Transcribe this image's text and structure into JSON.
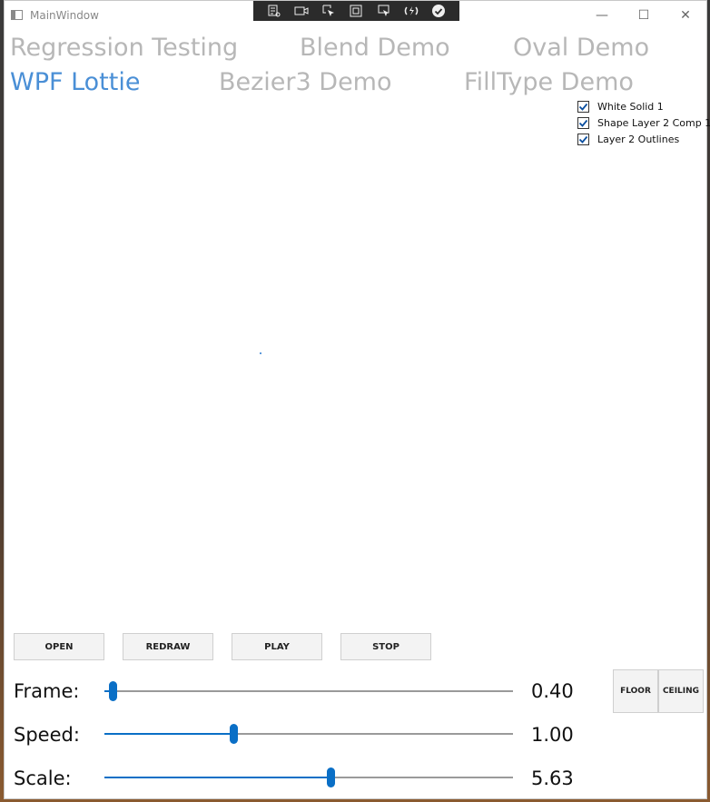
{
  "window": {
    "title": "MainWindow"
  },
  "window_controls": {
    "minimize": "—",
    "maximize": "☐",
    "close": "✕"
  },
  "debug_toolbar": {
    "icons": [
      "live-visual-tree-icon",
      "camera-icon",
      "select-element-icon",
      "layout-adorner-icon",
      "display-layout-icon",
      "hot-reload-icon",
      "check-icon"
    ]
  },
  "nav": {
    "regression": "Regression Testing",
    "blend": "Blend Demo",
    "oval": "Oval Demo",
    "wpf": "WPF Lottie",
    "bezier": "Bezier3 Demo",
    "filltype": "FillType Demo"
  },
  "layers": [
    {
      "label": "White Solid 1",
      "checked": true
    },
    {
      "label": "Shape Layer 2 Comp 1",
      "checked": true
    },
    {
      "label": "Layer 2 Outlines",
      "checked": true
    }
  ],
  "buttons": {
    "open": "OPEN",
    "redraw": "REDRAW",
    "play": "PLAY",
    "stop": "STOP",
    "floor": "FLOOR",
    "ceiling": "CEILING"
  },
  "controls": {
    "frame": {
      "label": "Frame:",
      "value": "0.40",
      "position": 0.02
    },
    "speed": {
      "label": "Speed:",
      "value": "1.00",
      "position": 0.315
    },
    "scale": {
      "label": "Scale:",
      "value": "5.63",
      "position": 0.553
    }
  },
  "colors": {
    "accent": "#0a6fc6",
    "active_nav": "#4a8fd6",
    "inactive_nav": "#b7b7b7"
  }
}
